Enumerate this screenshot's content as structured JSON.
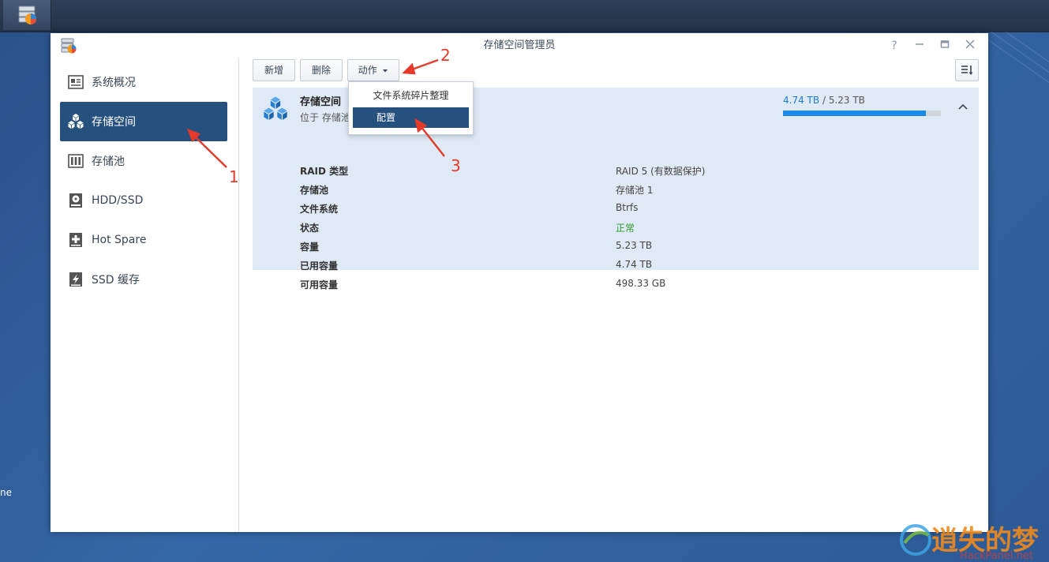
{
  "window": {
    "title": "存储空间管理员"
  },
  "sidebar": {
    "items": [
      {
        "label": "系统概况",
        "icon": "overview-icon"
      },
      {
        "label": "存储空间",
        "icon": "volume-cubes-icon",
        "active": true
      },
      {
        "label": "存储池",
        "icon": "storage-pool-icon"
      },
      {
        "label": "HDD/SSD",
        "icon": "disk-icon"
      },
      {
        "label": "Hot Spare",
        "icon": "hot-spare-icon"
      },
      {
        "label": "SSD 缓存",
        "icon": "ssd-cache-icon"
      }
    ]
  },
  "toolbar": {
    "create_label": "新增",
    "delete_label": "删除",
    "action_label": "动作"
  },
  "dropdown": {
    "items": [
      {
        "label": "文件系统碎片整理"
      },
      {
        "label": "配置",
        "selected": true
      }
    ]
  },
  "volume": {
    "name": "存储空间",
    "location": "位于 存储池",
    "used": "4.74 TB",
    "separator": "/",
    "total": "5.23 TB",
    "usage_fraction": 0.906,
    "properties": [
      {
        "label": "RAID 类型",
        "value": "RAID 5 (有数据保护)"
      },
      {
        "label": "存储池",
        "value": "存储池 1"
      },
      {
        "label": "文件系统",
        "value": "Btrfs"
      },
      {
        "label": "状态",
        "value": "正常",
        "status": "ok"
      },
      {
        "label": "容量",
        "value": "5.23 TB"
      },
      {
        "label": "已用容量",
        "value": "4.74 TB"
      },
      {
        "label": "可用容量",
        "value": "498.33 GB"
      }
    ]
  },
  "annotations": {
    "n1": "1",
    "n2": "2",
    "n3": "3"
  },
  "desktop": {
    "edge_text": "ne"
  },
  "watermark": {
    "text": "逍失的梦",
    "sub": "HackPanel.net"
  },
  "colors": {
    "accent": "#26507e",
    "usage_bar": "#1a8ae6",
    "status_ok": "#2e9b2e",
    "annotation": "#e53a2a"
  }
}
